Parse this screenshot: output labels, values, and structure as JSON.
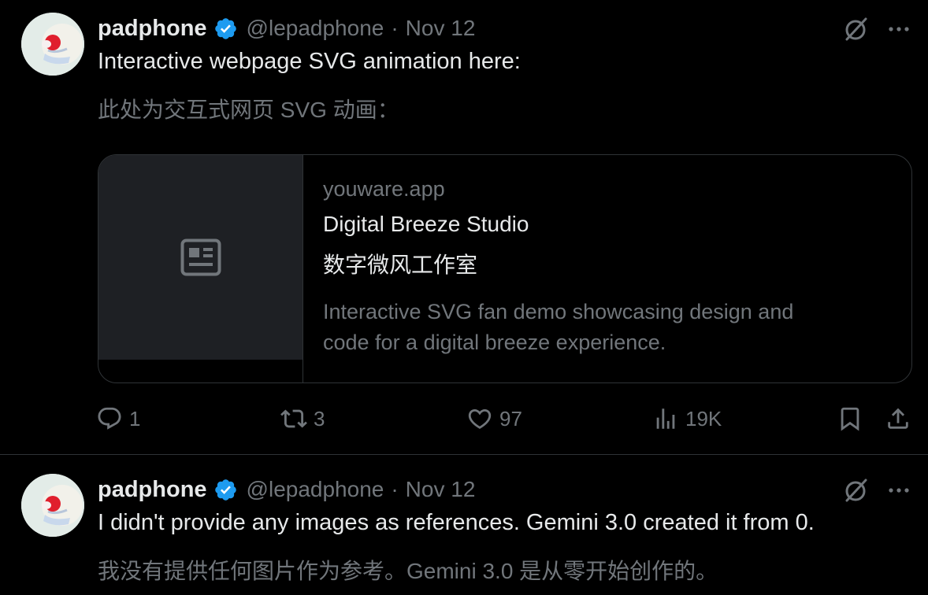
{
  "posts": [
    {
      "author": {
        "name": "padphone",
        "handle": "@lepadphone",
        "separator": "·",
        "time": "Nov 12",
        "verified": true
      },
      "text_en": "Interactive webpage SVG animation here:",
      "text_zh": "此处为交互式网页 SVG 动画：",
      "card": {
        "domain": "youware.app",
        "title": "Digital Breeze Studio",
        "title_zh": "数字微风工作室",
        "description_line1": "Interactive SVG fan demo showcasing design and",
        "description_line2": "code for a digital breeze experience.",
        "thumbnail_icon": "article-icon"
      },
      "metrics": {
        "replies": "1",
        "reposts": "3",
        "likes": "97",
        "views": "19K"
      }
    },
    {
      "author": {
        "name": "padphone",
        "handle": "@lepadphone",
        "separator": "·",
        "time": "Nov 12",
        "verified": true
      },
      "text_en": "I didn't provide any images as references. Gemini 3.0 created it from 0.",
      "text_zh": "我没有提供任何图片作为参考。Gemini 3.0 是从零开始创作的。"
    }
  ],
  "icons": {
    "verified": "verified-badge-icon",
    "grok": "grok-icon",
    "more": "more-icon",
    "reply": "reply-icon",
    "repost": "repost-icon",
    "like": "heart-icon",
    "views": "views-icon",
    "bookmark": "bookmark-icon",
    "share": "share-icon"
  },
  "colors": {
    "background": "#000000",
    "text_primary": "#e7e9ea",
    "text_secondary": "#71767b",
    "border": "#2f3336",
    "verified_blue": "#1d9bf0",
    "card_thumb_bg": "#1e2024"
  }
}
